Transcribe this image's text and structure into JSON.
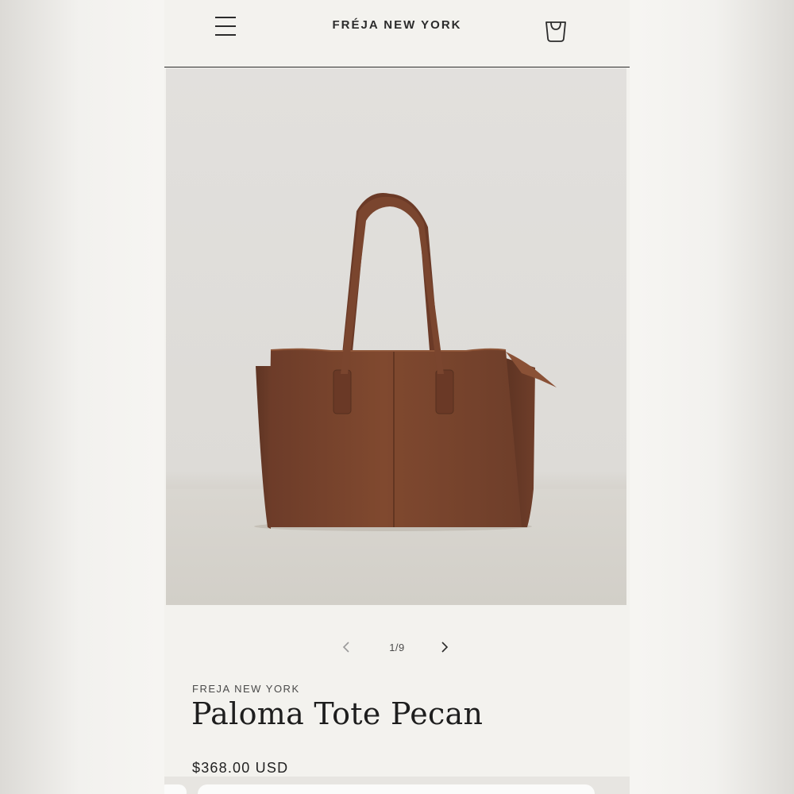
{
  "header": {
    "brand": "FRÉJA NEW YORK",
    "menu_icon": "hamburger-menu-icon",
    "cart_icon": "shopping-bag-icon"
  },
  "gallery": {
    "counter": "1/9",
    "current_index": 1,
    "total": 9,
    "prev_icon": "chevron-left-icon",
    "next_icon": "chevron-right-icon",
    "image_subject": "brown leather tote bag"
  },
  "product": {
    "vendor": "FREJA NEW YORK",
    "title": "Paloma Tote Pecan",
    "price": "$368.00 USD"
  },
  "colors": {
    "page_bg": "#f3f2ee",
    "bag_leather": "#7a4630",
    "text": "#1e1e1e"
  }
}
